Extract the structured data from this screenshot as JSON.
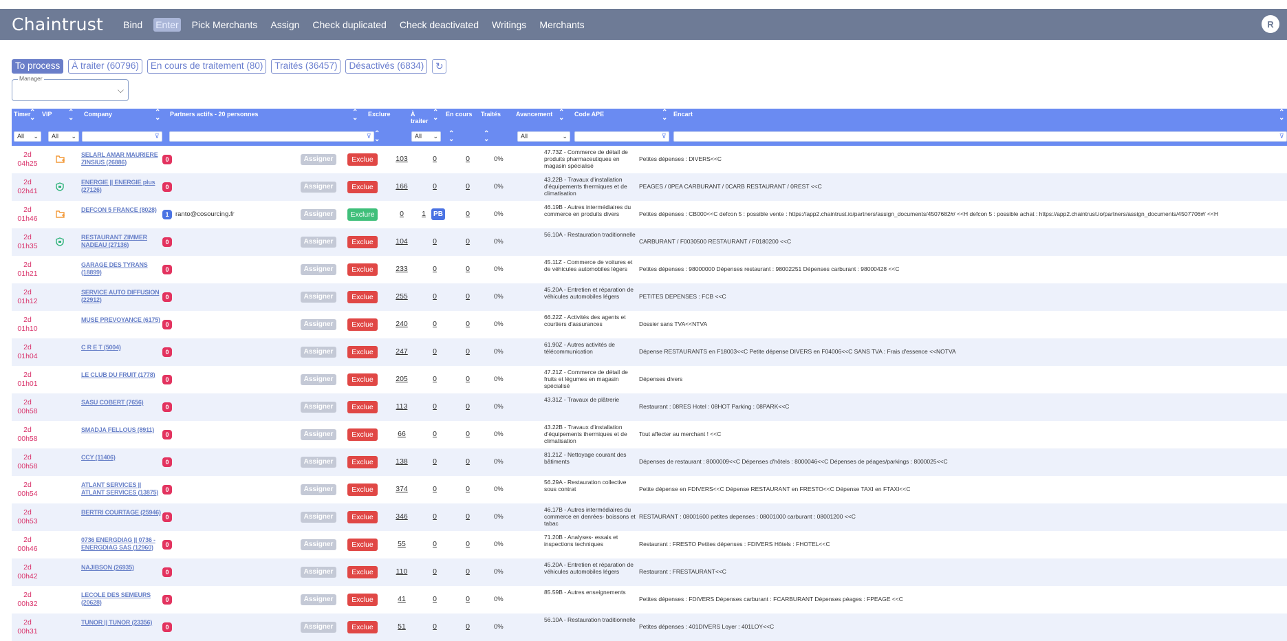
{
  "nav": {
    "brand": "Chaintrust",
    "items": [
      "Bind",
      "Enter",
      "Pick Merchants",
      "Assign",
      "Check duplicated",
      "Check deactivated",
      "Writings",
      "Merchants"
    ],
    "avatar": "R"
  },
  "tabs": [
    "To process",
    "À traiter (60796)",
    "En cours de traitement (80)",
    "Traités (36457)",
    "Désactivés (6834)"
  ],
  "refresh_icon": "↻",
  "manager": {
    "label": "Manager",
    "value": ""
  },
  "columns": {
    "timer": "Timer",
    "vip": "VIP",
    "company": "Company",
    "partners": "Partners actifs - 20 personnes",
    "exclure": "Exclure",
    "a_traiter": "À traiter",
    "en_cours": "En cours",
    "traites": "Traités",
    "avancement": "Avancement",
    "code_ape": "Code APE",
    "encart": "Encart"
  },
  "filters": {
    "timer": "All",
    "vip": "All",
    "a_traiter": "All",
    "avancement": "All"
  },
  "rows": [
    {
      "timer_d": "2d",
      "timer_h": "04h25",
      "vip": "folder-icon",
      "company": "SELARL AMAR MAURIERE ZINSIUS (26886)",
      "pcount": "0",
      "email": "",
      "assign": "Assigner",
      "exclude": "Exclue",
      "exclude_color": "red",
      "a_traiter": "103",
      "en_cours": "0",
      "pb": "",
      "traites": "0",
      "progress": "0%",
      "ape": "47.73Z - Commerce de détail de produits pharmaceutiques en magasin spécialisé",
      "encart": "Petites dépenses : DIVERS<<C"
    },
    {
      "timer_d": "2d",
      "timer_h": "02h41",
      "vip": "shield-icon",
      "company": "ENERGIE || ENERGIE plus (27126)",
      "pcount": "0",
      "email": "",
      "assign": "Assigner",
      "exclude": "Exclue",
      "exclude_color": "red",
      "a_traiter": "166",
      "en_cours": "0",
      "pb": "",
      "traites": "0",
      "progress": "0%",
      "ape": "43.22B - Travaux d'installation d'équipements thermiques et de climatisation",
      "encart": "PEAGES / 0PEA CARBURANT / 0CARB RESTAURANT / 0REST <<C"
    },
    {
      "timer_d": "2d",
      "timer_h": "01h46",
      "vip": "folder-icon",
      "company": "DEFCON 5 FRANCE (8028)",
      "pcount": "1",
      "email": "ranto@cosourcing.fr",
      "assign": "Assigner",
      "exclude": "Exclure",
      "exclude_color": "green",
      "a_traiter": "0",
      "en_cours": "1",
      "pb": "PB",
      "traites": "0",
      "progress": "0%",
      "ape": "46.19B - Autres intermédiaires du commerce en produits divers",
      "encart": "Petites dépenses : CB000<<C defcon 5 : possible vente : https://app2.chaintrust.io/partners/assign_documents/4507682#/ <<H defcon 5 : possible achat : https://app2.chaintrust.io/partners/assign_documents/4507706#/ <<H"
    },
    {
      "timer_d": "2d",
      "timer_h": "01h35",
      "vip": "shield-icon",
      "company": "RESTAURANT ZIMMER NADEAU (27136)",
      "pcount": "0",
      "email": "",
      "assign": "Assigner",
      "exclude": "Exclue",
      "exclude_color": "red",
      "a_traiter": "104",
      "en_cours": "0",
      "pb": "",
      "traites": "0",
      "progress": "0%",
      "ape": "56.10A - Restauration traditionnelle",
      "encart": "CARBURANT / F0030500 RESTAURANT / F0180200 <<C"
    },
    {
      "timer_d": "2d",
      "timer_h": "01h21",
      "vip": "",
      "company": "GARAGE DES TYRANS (18899)",
      "pcount": "0",
      "email": "",
      "assign": "Assigner",
      "exclude": "Exclue",
      "exclude_color": "red",
      "a_traiter": "233",
      "en_cours": "0",
      "pb": "",
      "traites": "0",
      "progress": "0%",
      "ape": "45.11Z - Commerce de voitures et de véhicules automobiles légers",
      "encart": "Petites dépenses : 98000000 Dépenses restaurant : 98002251 Dépenses carburant : 98000428 <<C"
    },
    {
      "timer_d": "2d",
      "timer_h": "01h12",
      "vip": "",
      "company": "SERVICE AUTO DIFFUSION (22912)",
      "pcount": "0",
      "email": "",
      "assign": "Assigner",
      "exclude": "Exclue",
      "exclude_color": "red",
      "a_traiter": "255",
      "en_cours": "0",
      "pb": "",
      "traites": "0",
      "progress": "0%",
      "ape": "45.20A - Entretien et réparation de véhicules automobiles légers",
      "encart": "PETITES DEPENSES : FCB <<C"
    },
    {
      "timer_d": "2d",
      "timer_h": "01h10",
      "vip": "",
      "company": "MUSE PREVOYANCE (6175)",
      "pcount": "0",
      "email": "",
      "assign": "Assigner",
      "exclude": "Exclue",
      "exclude_color": "red",
      "a_traiter": "240",
      "en_cours": "0",
      "pb": "",
      "traites": "0",
      "progress": "0%",
      "ape": "66.22Z - Activités des agents et courtiers d'assurances",
      "encart": "Dossier sans TVA<<NTVA"
    },
    {
      "timer_d": "2d",
      "timer_h": "01h04",
      "vip": "",
      "company": "C R E T (5004)",
      "pcount": "0",
      "email": "",
      "assign": "Assigner",
      "exclude": "Exclue",
      "exclude_color": "red",
      "a_traiter": "247",
      "en_cours": "0",
      "pb": "",
      "traites": "0",
      "progress": "0%",
      "ape": "61.90Z - Autres activités de télécommunication",
      "encart": "Dépense RESTAURANTS en F18003<<C Petite dépense DIVERS en F04006<<C SANS TVA : Frais d'essence <<NOTVA"
    },
    {
      "timer_d": "2d",
      "timer_h": "01h01",
      "vip": "",
      "company": "LE CLUB DU FRUIT (1778)",
      "pcount": "0",
      "email": "",
      "assign": "Assigner",
      "exclude": "Exclue",
      "exclude_color": "red",
      "a_traiter": "205",
      "en_cours": "0",
      "pb": "",
      "traites": "0",
      "progress": "0%",
      "ape": "47.21Z - Commerce de détail de fruits et légumes en magasin spécialisé",
      "encart": "Dépenses divers"
    },
    {
      "timer_d": "2d",
      "timer_h": "00h58",
      "vip": "",
      "company": "SASU COBERT (7656)",
      "pcount": "0",
      "email": "",
      "assign": "Assigner",
      "exclude": "Exclue",
      "exclude_color": "red",
      "a_traiter": "113",
      "en_cours": "0",
      "pb": "",
      "traites": "0",
      "progress": "0%",
      "ape": "43.31Z - Travaux de plâtrerie",
      "encart": "Restaurant : 08RES Hotel : 08HOT Parking : 08PARK<<C"
    },
    {
      "timer_d": "2d",
      "timer_h": "00h58",
      "vip": "",
      "company": "SMADJA FELLOUS (8911)",
      "pcount": "0",
      "email": "",
      "assign": "Assigner",
      "exclude": "Exclue",
      "exclude_color": "red",
      "a_traiter": "66",
      "en_cours": "0",
      "pb": "",
      "traites": "0",
      "progress": "0%",
      "ape": "43.22B - Travaux d'installation d'équipements thermiques et de climatisation",
      "encart": "Tout affecter au merchant ! <<C"
    },
    {
      "timer_d": "2d",
      "timer_h": "00h58",
      "vip": "",
      "company": "CCY (11406)",
      "pcount": "0",
      "email": "",
      "assign": "Assigner",
      "exclude": "Exclue",
      "exclude_color": "red",
      "a_traiter": "138",
      "en_cours": "0",
      "pb": "",
      "traites": "0",
      "progress": "0%",
      "ape": "81.21Z - Nettoyage courant des bâtiments",
      "encart": "Dépenses de restaurant : 8000009<<C Dépenses d'hôtels : 8000046<<C Dépenses de péages/parkings : 8000025<<C"
    },
    {
      "timer_d": "2d",
      "timer_h": "00h54",
      "vip": "",
      "company": "ATLANT SERVICES || ATLANT SERVICES (13875)",
      "pcount": "0",
      "email": "",
      "assign": "Assigner",
      "exclude": "Exclue",
      "exclude_color": "red",
      "a_traiter": "374",
      "en_cours": "0",
      "pb": "",
      "traites": "0",
      "progress": "0%",
      "ape": "56.29A - Restauration collective sous contrat",
      "encart": "Petite dépense en FDIVERS<<C Dépense RESTAURANT en FRESTO<<C Dépense TAXI en FTAXI<<C"
    },
    {
      "timer_d": "2d",
      "timer_h": "00h53",
      "vip": "",
      "company": "BERTRI COURTAGE (25946)",
      "pcount": "0",
      "email": "",
      "assign": "Assigner",
      "exclude": "Exclue",
      "exclude_color": "red",
      "a_traiter": "346",
      "en_cours": "0",
      "pb": "",
      "traites": "0",
      "progress": "0%",
      "ape": "46.17B - Autres intermédiaires du commerce en denrées- boissons et tabac",
      "encart": "RESTAURANT : 08001600 petites depenses : 08001000 carburant : 08001200 <<C"
    },
    {
      "timer_d": "2d",
      "timer_h": "00h46",
      "vip": "",
      "company": "0736 ENERGDIAG || 0736 - ENERGDIAG SAS (12960)",
      "pcount": "0",
      "email": "",
      "assign": "Assigner",
      "exclude": "Exclue",
      "exclude_color": "red",
      "a_traiter": "55",
      "en_cours": "0",
      "pb": "",
      "traites": "0",
      "progress": "0%",
      "ape": "71.20B - Analyses- essais et inspections techniques",
      "encart": "Restaurant : FRESTO Petites dépenses : FDIVERS Hôtels : FHOTEL<<C"
    },
    {
      "timer_d": "2d",
      "timer_h": "00h42",
      "vip": "",
      "company": "NAJIBSON (26935)",
      "pcount": "0",
      "email": "",
      "assign": "Assigner",
      "exclude": "Exclue",
      "exclude_color": "red",
      "a_traiter": "110",
      "en_cours": "0",
      "pb": "",
      "traites": "0",
      "progress": "0%",
      "ape": "45.20A - Entretien et réparation de véhicules automobiles légers",
      "encart": "Restaurant : FRESTAURANT<<C"
    },
    {
      "timer_d": "2d",
      "timer_h": "00h32",
      "vip": "",
      "company": "LECOLE DES SEMEURS (20628)",
      "pcount": "0",
      "email": "",
      "assign": "Assigner",
      "exclude": "Exclue",
      "exclude_color": "red",
      "a_traiter": "41",
      "en_cours": "0",
      "pb": "",
      "traites": "0",
      "progress": "0%",
      "ape": "85.59B - Autres enseignements",
      "encart": "Petites dépenses : FDIVERS Dépenses carburant : FCARBURANT Dépenses péages : FPEAGE <<C"
    },
    {
      "timer_d": "2d",
      "timer_h": "00h31",
      "vip": "",
      "company": "TUNOR || TUNOR (23356)",
      "pcount": "0",
      "email": "",
      "assign": "Assigner",
      "exclude": "Exclue",
      "exclude_color": "red",
      "a_traiter": "51",
      "en_cours": "0",
      "pb": "",
      "traites": "0",
      "progress": "0%",
      "ape": "56.10A - Restauration traditionnelle",
      "encart": "Petites dépenses : 401DIVERS Loyer : 401LOY<<C"
    }
  ],
  "colors": {
    "nav": "#6e7b96",
    "header": "#6a8bf2",
    "exclue": "#e04745",
    "exclure": "#3fbf7a",
    "timer": "#d9336b",
    "pb": "#4b73e3"
  }
}
